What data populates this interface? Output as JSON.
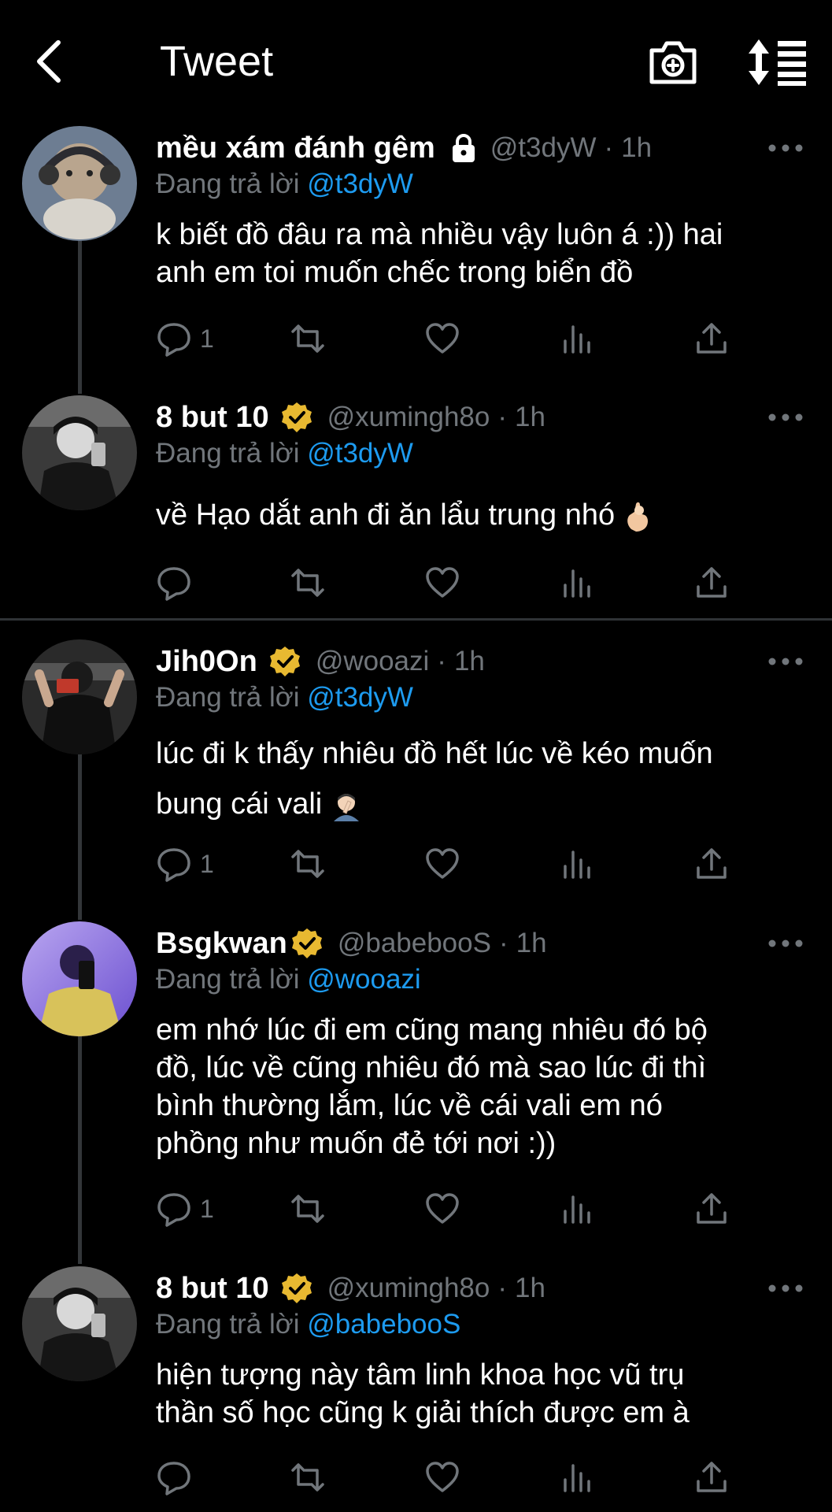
{
  "header": {
    "title": "Tweet",
    "back_icon": "chevron-left-icon",
    "camera_icon": "camera-add-icon",
    "sort_icon": "sort-icon"
  },
  "colors": {
    "background": "#000000",
    "text": "#ffffff",
    "muted": "#71767b",
    "link": "#1d9bf0",
    "verified": "#e8b931"
  },
  "tweets": [
    {
      "display_name": "mều xám đánh gêm",
      "handle": "@t3dyW",
      "time": "1h",
      "protected": true,
      "verified": false,
      "reply_prefix": "Đang trả lời",
      "reply_to": "@t3dyW",
      "text_lines": [
        "k biết đồ đâu ra mà nhiều vậy luôn á :)) hai",
        "anh em toi muốn chếc trong biển đồ"
      ],
      "reply_count": "1"
    },
    {
      "display_name": "8 but 10",
      "handle": "@xumingh8o",
      "time": "1h",
      "protected": false,
      "verified": true,
      "reply_prefix": "Đang trả lời",
      "reply_to": "@t3dyW",
      "text_lines": [
        "về Hạo dắt anh đi ăn lẩu trung nhó"
      ],
      "reply_count": ""
    },
    {
      "display_name": "Jih0On",
      "handle": "@wooazi",
      "time": "1h",
      "protected": false,
      "verified": true,
      "reply_prefix": "Đang trả lời",
      "reply_to": "@t3dyW",
      "text_lines": [
        "lúc đi k thấy nhiêu đồ hết lúc về kéo muốn",
        "bung cái vali"
      ],
      "reply_count": "1"
    },
    {
      "display_name": "Bsgkwan",
      "handle": "@babebooS",
      "time": "1h",
      "protected": false,
      "verified": true,
      "reply_prefix": "Đang trả lời",
      "reply_to": "@wooazi",
      "text_lines": [
        "em nhớ lúc đi em cũng mang nhiêu đó bộ",
        "đồ, lúc về cũng nhiêu đó mà sao lúc đi thì",
        "bình thường lắm, lúc về cái vali em nó",
        "phồng như muốn đẻ tới nơi  :))"
      ],
      "reply_count": "1"
    },
    {
      "display_name": "8 but 10",
      "handle": "@xumingh8o",
      "time": "1h",
      "protected": false,
      "verified": true,
      "reply_prefix": "Đang trả lời",
      "reply_to": "@babebooS",
      "text_lines": [
        "hiện tượng này tâm linh khoa học vũ trụ",
        "thần số học cũng k giải thích được em à"
      ],
      "reply_count": ""
    }
  ]
}
